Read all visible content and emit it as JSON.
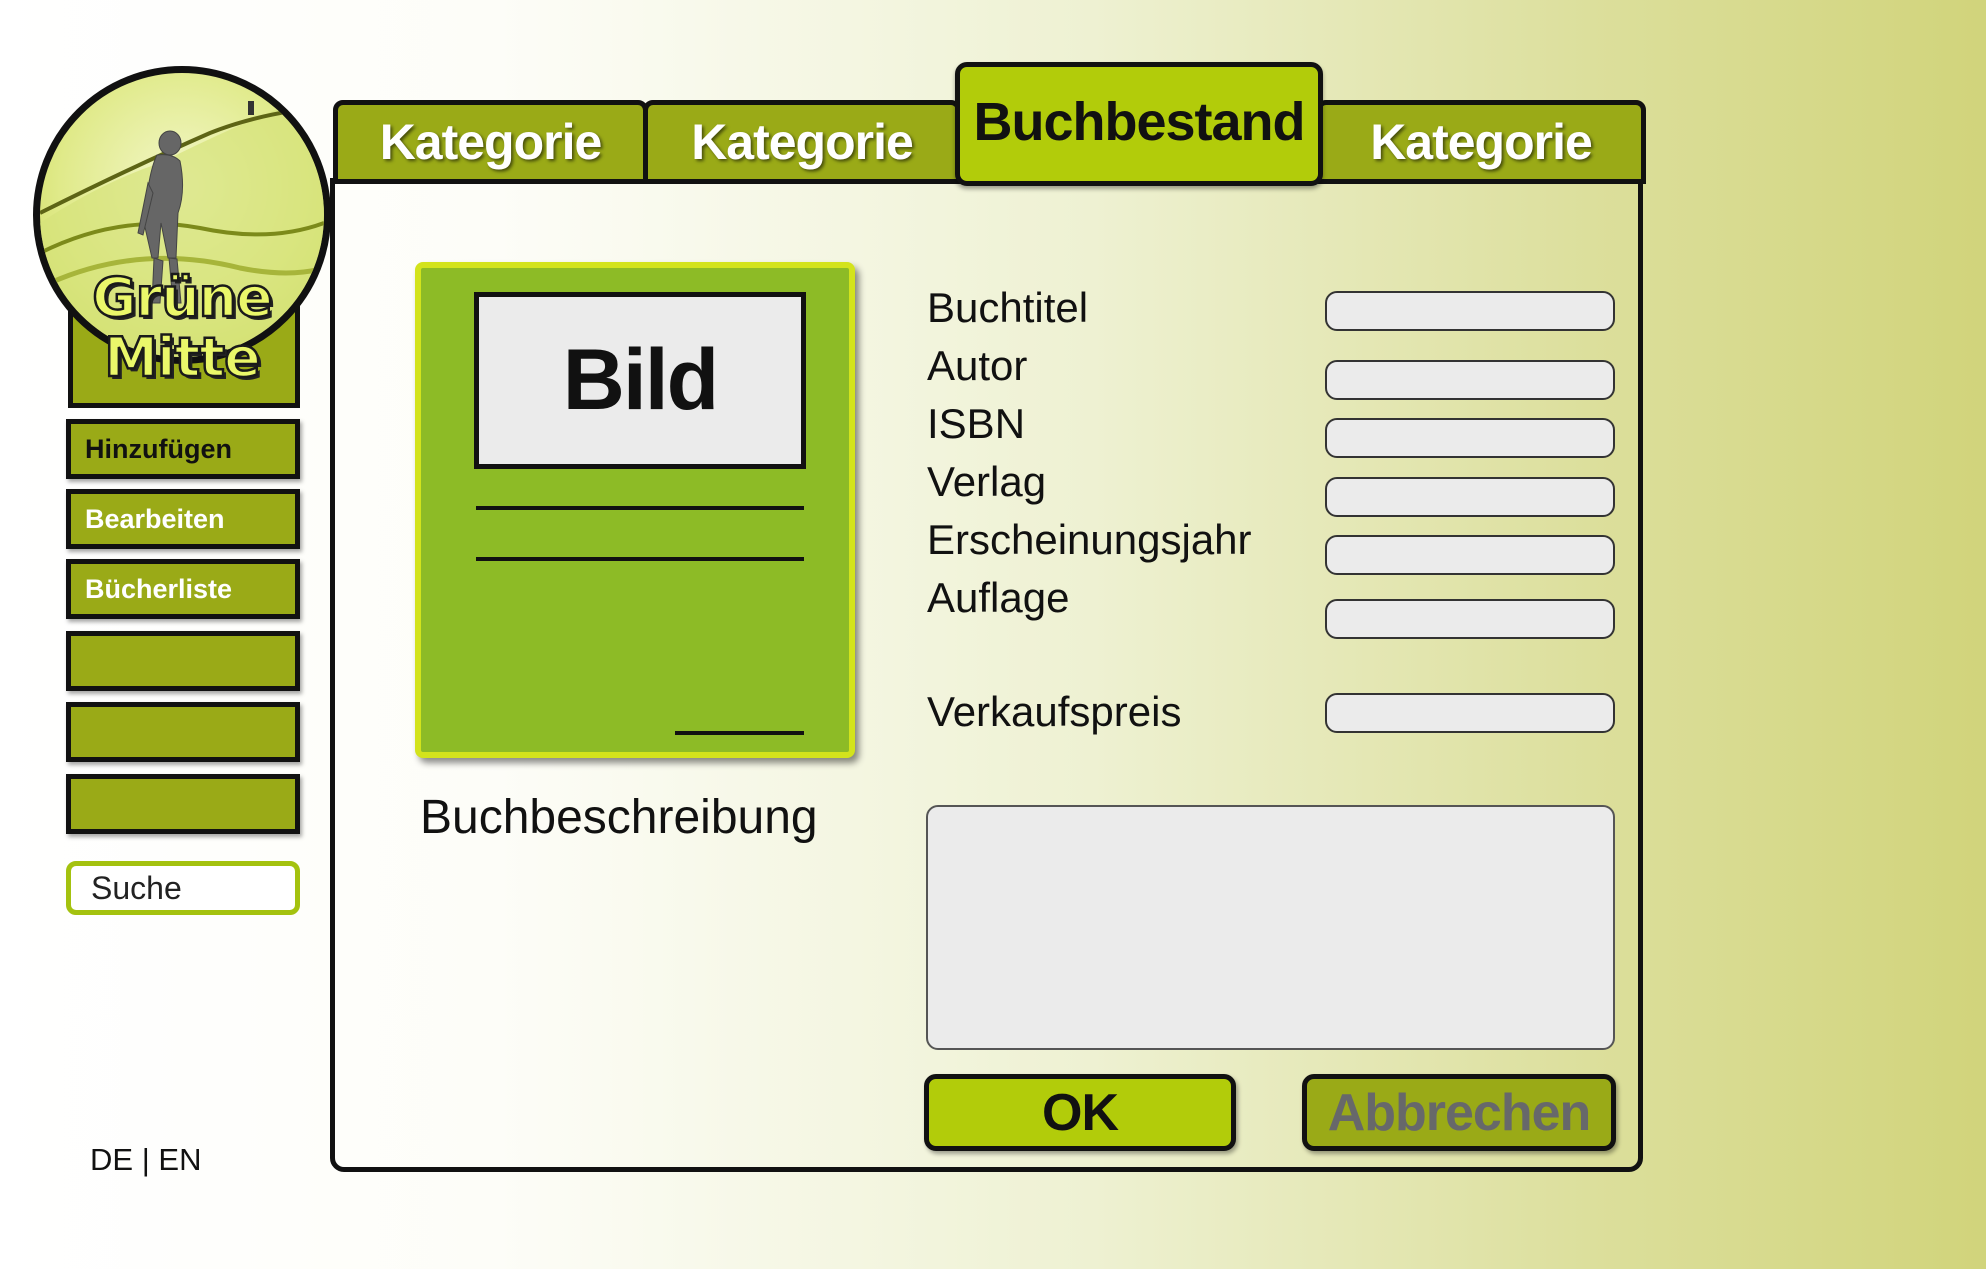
{
  "logo": {
    "line1": "Grüne",
    "line2": "Mitte"
  },
  "sidebar": {
    "items": [
      {
        "label": "Hinzufügen"
      },
      {
        "label": "Bearbeiten"
      },
      {
        "label": "Bücherliste"
      },
      {
        "label": ""
      },
      {
        "label": ""
      },
      {
        "label": ""
      }
    ],
    "search_placeholder": "Suche"
  },
  "language": {
    "de": "DE",
    "separator": "|",
    "en": "EN"
  },
  "tabs": [
    {
      "label": "Kategorie"
    },
    {
      "label": "Kategorie"
    },
    {
      "label": "Buchbestand",
      "active": true
    },
    {
      "label": "Kategorie"
    }
  ],
  "book": {
    "image_label": "Bild",
    "description_label": "Buchbeschreibung"
  },
  "form": {
    "fields": [
      {
        "label": "Buchtitel",
        "value": ""
      },
      {
        "label": "Autor",
        "value": ""
      },
      {
        "label": "ISBN",
        "value": ""
      },
      {
        "label": "Verlag",
        "value": ""
      },
      {
        "label": "Erscheinungsjahr",
        "value": ""
      },
      {
        "label": "Auflage",
        "value": ""
      },
      {
        "label": "Verkaufspreis",
        "value": ""
      }
    ],
    "description_value": ""
  },
  "actions": {
    "ok": "OK",
    "cancel": "Abbrechen"
  },
  "colors": {
    "tab_green": "#9aaa17",
    "active_green": "#b2cc0a",
    "card_green": "#8dbb26",
    "field_gray": "#ebebeb"
  }
}
